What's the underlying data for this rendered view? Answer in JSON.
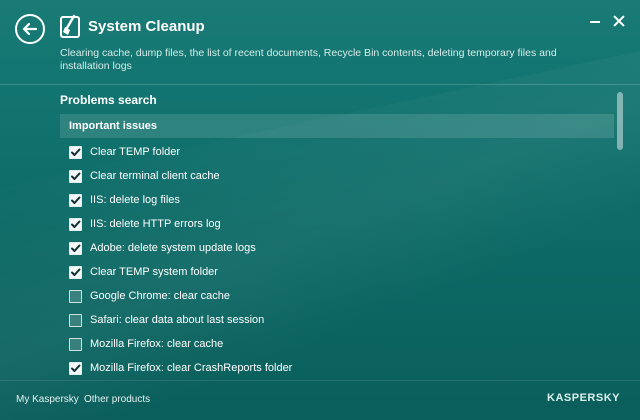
{
  "window": {
    "title": "System Cleanup",
    "description": "Clearing cache, dump files, the list of recent documents, Recycle Bin contents, deleting temporary files and installation logs"
  },
  "section": {
    "title": "Problems search",
    "group_title": "Important issues"
  },
  "items": [
    {
      "label": "Clear TEMP folder",
      "checked": true
    },
    {
      "label": "Clear terminal client cache",
      "checked": true
    },
    {
      "label": "IIS: delete log files",
      "checked": true
    },
    {
      "label": "IIS: delete HTTP errors log",
      "checked": true
    },
    {
      "label": "Adobe: delete system update logs",
      "checked": true
    },
    {
      "label": "Clear TEMP system folder",
      "checked": true
    },
    {
      "label": "Google Chrome: clear cache",
      "checked": false
    },
    {
      "label": "Safari: clear data about last session",
      "checked": false
    },
    {
      "label": "Mozilla Firefox: clear cache",
      "checked": false
    },
    {
      "label": "Mozilla Firefox: clear CrashReports folder",
      "checked": true
    }
  ],
  "footer": {
    "my_kaspersky": "My Kaspersky",
    "other_products": "Other products",
    "logo_text": "KASPERSKY"
  },
  "icons": {
    "back": "arrow-left-icon",
    "app": "broom-icon",
    "minimize": "minimize-icon",
    "close": "close-icon",
    "checkbox_checked": "checkmark-icon"
  },
  "colors": {
    "background": "#137571",
    "text": "#ffffff"
  }
}
